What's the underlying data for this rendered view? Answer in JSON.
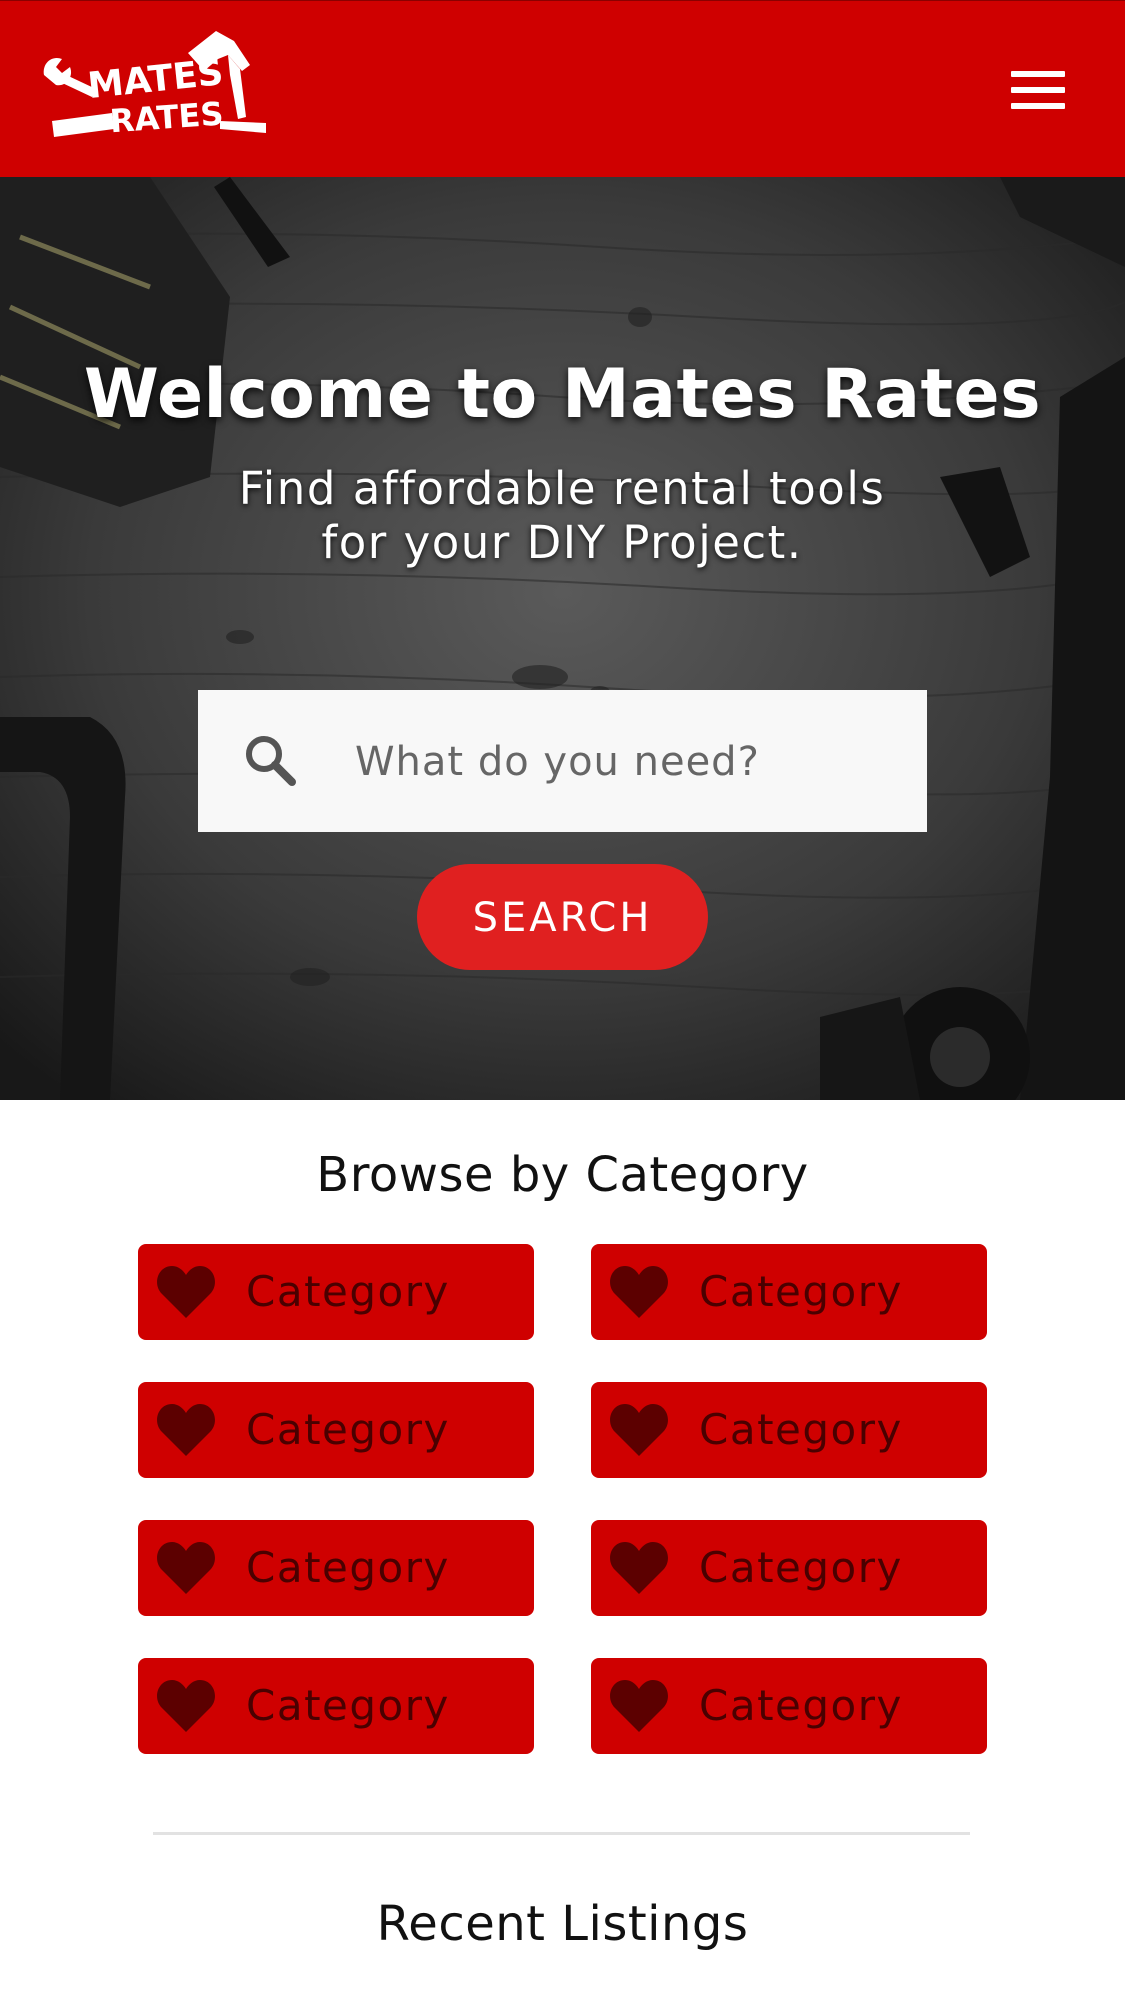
{
  "header": {
    "logo_line1": "MATES",
    "logo_line2": "RATES"
  },
  "hero": {
    "title": "Welcome to Mates Rates",
    "subtitle_line1": "Find affordable rental tools",
    "subtitle_line2": "for your DIY Project.",
    "search_placeholder": "What do you need?",
    "search_button": "SEARCH"
  },
  "browse": {
    "title": "Browse by Category",
    "categories": [
      {
        "label": "Category",
        "icon": "heart-icon"
      },
      {
        "label": "Category",
        "icon": "heart-icon"
      },
      {
        "label": "Category",
        "icon": "heart-icon"
      },
      {
        "label": "Category",
        "icon": "heart-icon"
      },
      {
        "label": "Category",
        "icon": "heart-icon"
      },
      {
        "label": "Category",
        "icon": "heart-icon"
      },
      {
        "label": "Category",
        "icon": "heart-icon"
      },
      {
        "label": "Category",
        "icon": "heart-icon"
      }
    ]
  },
  "recent": {
    "title": "Recent Listings"
  },
  "colors": {
    "brand_red": "#cf0000",
    "button_red": "#e02020",
    "category_text": "#4a0000",
    "heart_dark": "#5c0000"
  }
}
